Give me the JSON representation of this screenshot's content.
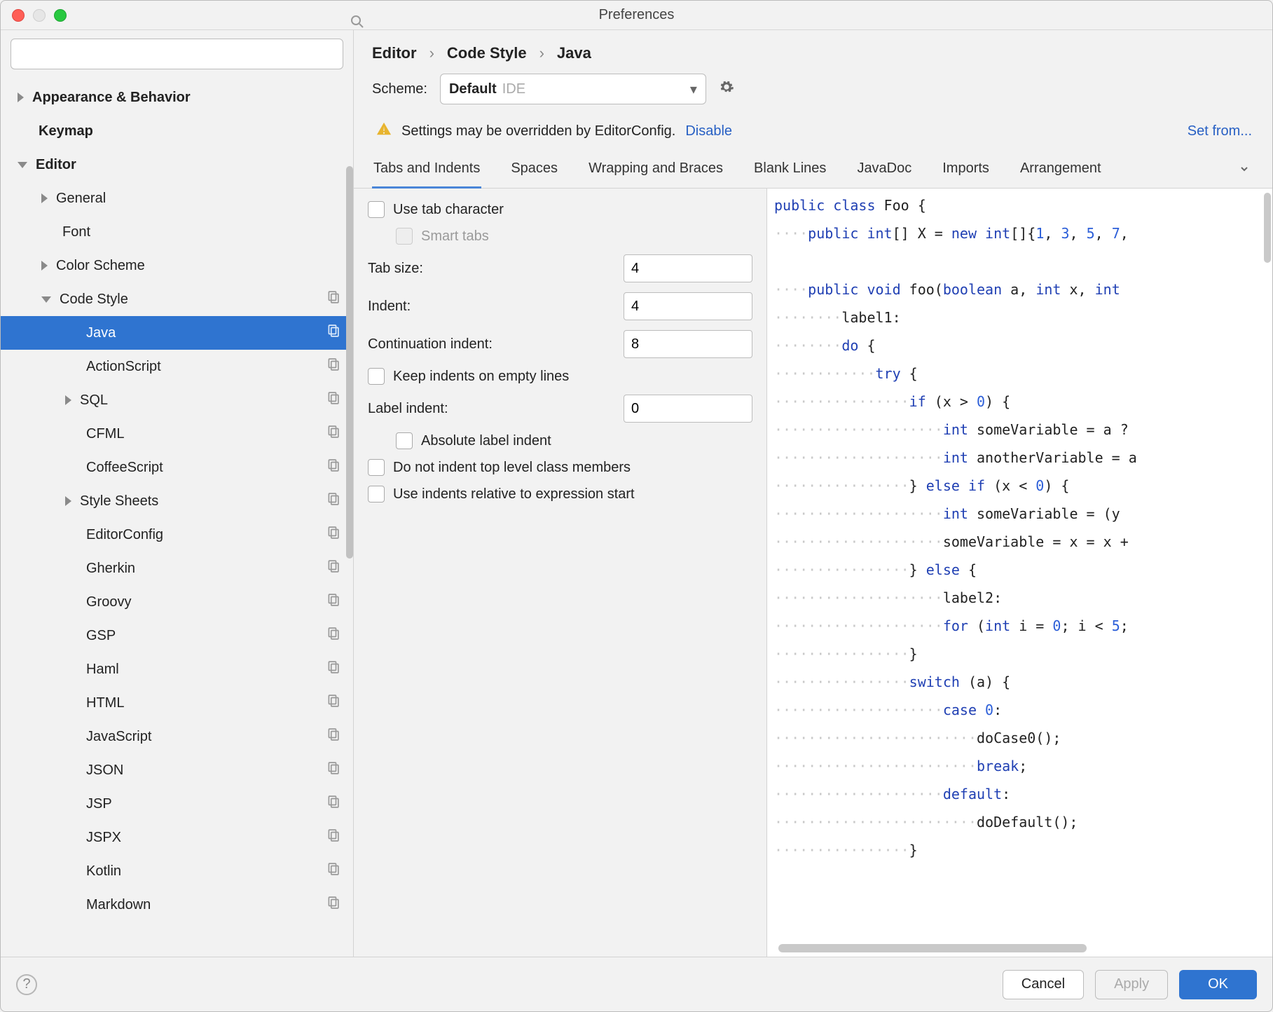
{
  "window_title": "Preferences",
  "search_placeholder": "",
  "sidebar": {
    "items": [
      {
        "label": "Appearance & Behavior",
        "level": 0,
        "arrow": "right",
        "bold": true
      },
      {
        "label": "Keymap",
        "level": 0,
        "arrow": "none",
        "bold": true
      },
      {
        "label": "Editor",
        "level": 0,
        "arrow": "down",
        "bold": true
      },
      {
        "label": "General",
        "level": 1,
        "arrow": "right"
      },
      {
        "label": "Font",
        "level": 1,
        "arrow": "none"
      },
      {
        "label": "Color Scheme",
        "level": 1,
        "arrow": "right"
      },
      {
        "label": "Code Style",
        "level": 1,
        "arrow": "down",
        "copy": true
      },
      {
        "label": "Java",
        "level": 2,
        "arrow": "none",
        "copy": true,
        "selected": true
      },
      {
        "label": "ActionScript",
        "level": 2,
        "arrow": "none",
        "copy": true
      },
      {
        "label": "SQL",
        "level": 2,
        "arrow": "right",
        "copy": true
      },
      {
        "label": "CFML",
        "level": 2,
        "arrow": "none",
        "copy": true
      },
      {
        "label": "CoffeeScript",
        "level": 2,
        "arrow": "none",
        "copy": true
      },
      {
        "label": "Style Sheets",
        "level": 2,
        "arrow": "right",
        "copy": true
      },
      {
        "label": "EditorConfig",
        "level": 2,
        "arrow": "none",
        "copy": true
      },
      {
        "label": "Gherkin",
        "level": 2,
        "arrow": "none",
        "copy": true
      },
      {
        "label": "Groovy",
        "level": 2,
        "arrow": "none",
        "copy": true
      },
      {
        "label": "GSP",
        "level": 2,
        "arrow": "none",
        "copy": true
      },
      {
        "label": "Haml",
        "level": 2,
        "arrow": "none",
        "copy": true
      },
      {
        "label": "HTML",
        "level": 2,
        "arrow": "none",
        "copy": true
      },
      {
        "label": "JavaScript",
        "level": 2,
        "arrow": "none",
        "copy": true
      },
      {
        "label": "JSON",
        "level": 2,
        "arrow": "none",
        "copy": true
      },
      {
        "label": "JSP",
        "level": 2,
        "arrow": "none",
        "copy": true
      },
      {
        "label": "JSPX",
        "level": 2,
        "arrow": "none",
        "copy": true
      },
      {
        "label": "Kotlin",
        "level": 2,
        "arrow": "none",
        "copy": true
      },
      {
        "label": "Markdown",
        "level": 2,
        "arrow": "none",
        "copy": true
      }
    ]
  },
  "breadcrumb": {
    "a": "Editor",
    "b": "Code Style",
    "c": "Java"
  },
  "scheme": {
    "label": "Scheme:",
    "value": "Default",
    "tag": "IDE"
  },
  "setfrom": "Set from...",
  "warning": {
    "text": "Settings may be overridden by EditorConfig.",
    "link": "Disable"
  },
  "tabs": [
    "Tabs and Indents",
    "Spaces",
    "Wrapping and Braces",
    "Blank Lines",
    "JavaDoc",
    "Imports",
    "Arrangement"
  ],
  "form": {
    "use_tab": "Use tab character",
    "smart_tabs": "Smart tabs",
    "tab_size_label": "Tab size:",
    "tab_size": "4",
    "indent_label": "Indent:",
    "indent": "4",
    "cont_label": "Continuation indent:",
    "cont": "8",
    "keep_empty": "Keep indents on empty lines",
    "label_indent_label": "Label indent:",
    "label_indent": "0",
    "abs_label": "Absolute label indent",
    "no_top": "Do not indent top level class members",
    "rel_expr": "Use indents relative to expression start"
  },
  "footer": {
    "cancel": "Cancel",
    "apply": "Apply",
    "ok": "OK"
  }
}
